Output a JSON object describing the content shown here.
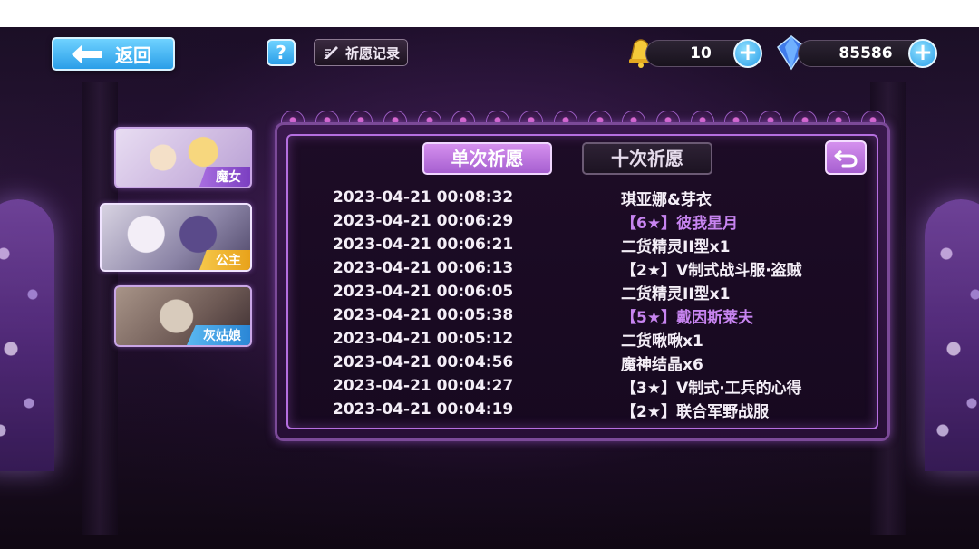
{
  "topbar": {
    "back_label": "返回",
    "help_label": "?",
    "record_label": "祈愿记录",
    "currency_bell": "10",
    "currency_crystal": "85586",
    "plus_label": "+"
  },
  "side_cards": [
    {
      "label": "魔女"
    },
    {
      "label": "公主"
    },
    {
      "label": "灰姑娘"
    }
  ],
  "tabs": {
    "single": "单次祈愿",
    "ten": "十次祈愿"
  },
  "records": [
    {
      "time": "2023-04-21 00:08:32",
      "item": "琪亚娜&芽衣",
      "rare": false
    },
    {
      "time": "2023-04-21 00:06:29",
      "item": "【6★】彼我星月",
      "rare": true
    },
    {
      "time": "2023-04-21 00:06:21",
      "item": "二货精灵II型x1",
      "rare": false
    },
    {
      "time": "2023-04-21 00:06:13",
      "item": "【2★】V制式战斗服·盗贼",
      "rare": false
    },
    {
      "time": "2023-04-21 00:06:05",
      "item": "二货精灵II型x1",
      "rare": false
    },
    {
      "time": "2023-04-21 00:05:38",
      "item": "【5★】戴因斯莱夫",
      "rare": true
    },
    {
      "time": "2023-04-21 00:05:12",
      "item": "二货啾啾x1",
      "rare": false
    },
    {
      "time": "2023-04-21 00:04:56",
      "item": "魔神结晶x6",
      "rare": false
    },
    {
      "time": "2023-04-21 00:04:27",
      "item": "【3★】V制式·工兵的心得",
      "rare": false
    },
    {
      "time": "2023-04-21 00:04:19",
      "item": "【2★】联合军野战服",
      "rare": false
    }
  ],
  "colors": {
    "accent_blue": "#2a9ee8",
    "accent_purple": "#a65fd0",
    "rare_text": "#c784f0"
  }
}
